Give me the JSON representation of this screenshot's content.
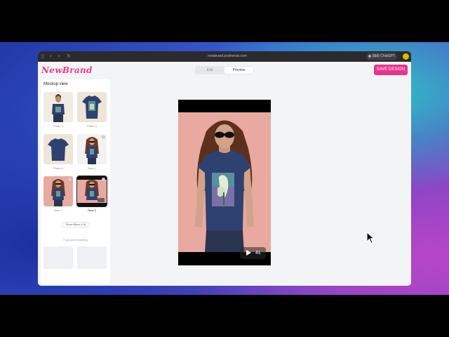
{
  "browser": {
    "url": "newbrand.podmeow.com",
    "extension_label": "抽出 ChatGPT"
  },
  "header": {
    "logo": "NewBrand",
    "toggle": {
      "edit": "Edit",
      "preview": "Preview",
      "active": "Preview"
    },
    "save_button": "SAVE DESIGN"
  },
  "sidebar": {
    "title": "Mockup view",
    "thumbnails": [
      {
        "label": "Photo 3",
        "kind": "model-front",
        "removable": false
      },
      {
        "label": "Photo 4",
        "kind": "shirt-flat-graphic",
        "removable": false
      },
      {
        "label": "Photo 5",
        "kind": "shirt-flat-back",
        "removable": false
      },
      {
        "label": "New 1",
        "kind": "model-sunglasses",
        "removable": true
      },
      {
        "label": "New 2",
        "kind": "model-sunglasses",
        "removable": true
      },
      {
        "label": "New 3",
        "kind": "model-video",
        "removable": true,
        "selected": true,
        "badge": "4s"
      }
    ],
    "show_more": "Show More (+3)",
    "groups_remaining": "5 groups remaining"
  },
  "preview": {
    "video_duration": "4s"
  },
  "colors": {
    "brand": "#e83c8c",
    "save_button": "#e8358a",
    "shirt": "#2f4170",
    "preview_background": "#e8a9a0"
  }
}
